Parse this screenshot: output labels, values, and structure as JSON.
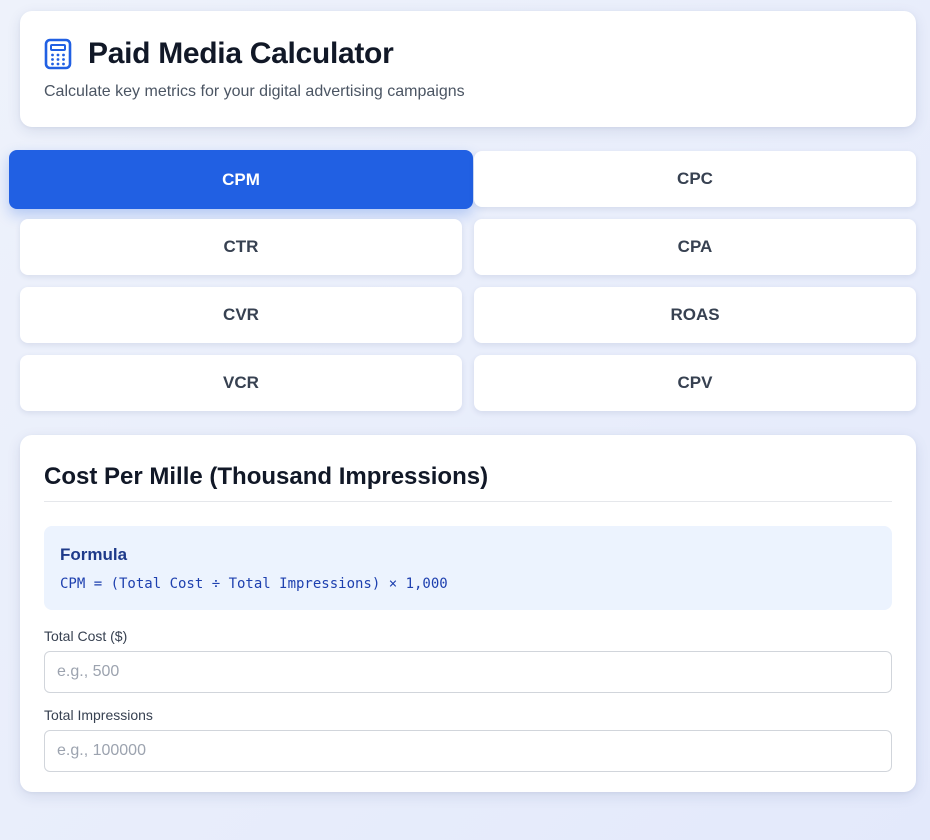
{
  "header": {
    "title": "Paid Media Calculator",
    "subtitle": "Calculate key metrics for your digital advertising campaigns",
    "icon": "calculator-icon"
  },
  "tabs": [
    {
      "label": "CPM",
      "active": true
    },
    {
      "label": "CPC",
      "active": false
    },
    {
      "label": "CTR",
      "active": false
    },
    {
      "label": "CPA",
      "active": false
    },
    {
      "label": "CVR",
      "active": false
    },
    {
      "label": "ROAS",
      "active": false
    },
    {
      "label": "VCR",
      "active": false
    },
    {
      "label": "CPV",
      "active": false
    }
  ],
  "calculator": {
    "title": "Cost Per Mille (Thousand Impressions)",
    "formula_label": "Formula",
    "formula": "CPM = (Total Cost ÷ Total Impressions) × 1,000",
    "fields": [
      {
        "label": "Total Cost ($)",
        "placeholder": "e.g., 500",
        "value": ""
      },
      {
        "label": "Total Impressions",
        "placeholder": "e.g., 100000",
        "value": ""
      }
    ]
  },
  "colors": {
    "accent": "#2160e3",
    "formula_bg": "#ecf3fe",
    "formula_text": "#1e40af"
  }
}
